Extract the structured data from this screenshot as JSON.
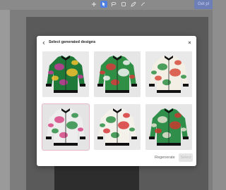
{
  "toolbar": {
    "tools": [
      "plus-icon",
      "cursor-icon",
      "lasso-icon",
      "crop-icon",
      "pen-icon",
      "more-icon"
    ],
    "active_index": 1,
    "get_label": "Get pl"
  },
  "dialog": {
    "title": "Select generated designs",
    "back_icon": "chevron-left-icon",
    "close_icon": "close-icon",
    "designs": [
      {
        "body": "#1f7a3a",
        "accent": "#c43a9a",
        "splash": "#f4c02f",
        "collar": "#111111",
        "bg": "#e9e9e9",
        "selected": false
      },
      {
        "body": "#2e8f45",
        "accent": "#d63b3b",
        "splash": "#f2f2f2",
        "collar": "#111111",
        "bg": "#e6e6e6",
        "selected": false
      },
      {
        "body": "#f3efe4",
        "accent": "#2e8f45",
        "splash": "#d64b3b",
        "collar": "#111111",
        "bg": "#e9e9e9",
        "selected": false
      },
      {
        "body": "#ededed",
        "accent": "#d64585",
        "splash": "#2e8f45",
        "collar": "#111111",
        "bg": "#e4e4e4",
        "selected": true
      },
      {
        "body": "#f4f1ea",
        "accent": "#2e8f45",
        "splash": "#d63b3b",
        "collar": "#111111",
        "bg": "#e9e9e9",
        "selected": false
      },
      {
        "body": "#2f8f4a",
        "accent": "#e8e2d2",
        "splash": "#c8392f",
        "collar": "#111111",
        "bg": "#e6e6e6",
        "selected": false
      }
    ],
    "regenerate_label": "Regenerate",
    "select_label": "Select"
  }
}
